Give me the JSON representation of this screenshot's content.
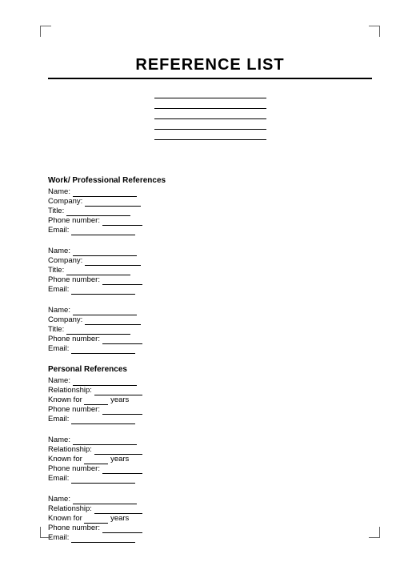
{
  "title": "REFERENCE LIST",
  "sections": {
    "work": {
      "heading": "Work/ Professional References",
      "fields": {
        "name": "Name:",
        "company": "Company:",
        "title": "Title:",
        "phone": "Phone number:",
        "email": "Email:"
      }
    },
    "personal": {
      "heading": "Personal References",
      "fields": {
        "name": "Name:",
        "relationship": "Relationship:",
        "known_for": "Known for",
        "years": "years",
        "phone": "Phone number:",
        "email": "Email:"
      }
    }
  }
}
